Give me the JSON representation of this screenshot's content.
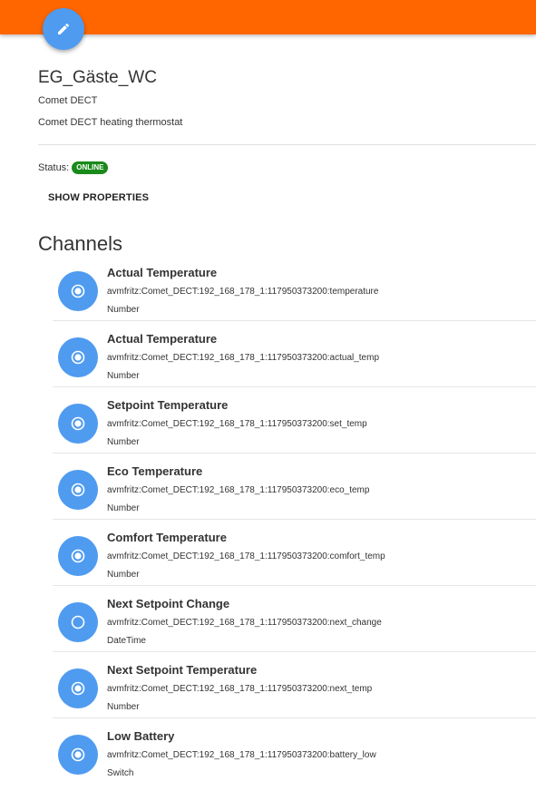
{
  "header": {
    "bar_color": "#ff6600",
    "edit_icon": "pencil-icon"
  },
  "thing": {
    "name": "EG_Gäste_WC",
    "type": "Comet DECT",
    "description": "Comet DECT heating thermostat",
    "status_label": "Status:",
    "status_value": "ONLINE",
    "status_color": "#1a8a1a",
    "show_properties_label": "SHOW PROPERTIES"
  },
  "channels": {
    "title": "Channels",
    "items": [
      {
        "label": "Actual Temperature",
        "uid": "avmfritz:Comet_DECT:192_168_178_1:117950373200:temperature",
        "type": "Number",
        "linked": true
      },
      {
        "label": "Actual Temperature",
        "uid": "avmfritz:Comet_DECT:192_168_178_1:117950373200:actual_temp",
        "type": "Number",
        "linked": true
      },
      {
        "label": "Setpoint Temperature",
        "uid": "avmfritz:Comet_DECT:192_168_178_1:117950373200:set_temp",
        "type": "Number",
        "linked": true
      },
      {
        "label": "Eco Temperature",
        "uid": "avmfritz:Comet_DECT:192_168_178_1:117950373200:eco_temp",
        "type": "Number",
        "linked": true
      },
      {
        "label": "Comfort Temperature",
        "uid": "avmfritz:Comet_DECT:192_168_178_1:117950373200:comfort_temp",
        "type": "Number",
        "linked": true
      },
      {
        "label": "Next Setpoint Change",
        "uid": "avmfritz:Comet_DECT:192_168_178_1:117950373200:next_change",
        "type": "DateTime",
        "linked": false
      },
      {
        "label": "Next Setpoint Temperature",
        "uid": "avmfritz:Comet_DECT:192_168_178_1:117950373200:next_temp",
        "type": "Number",
        "linked": true
      },
      {
        "label": "Low Battery",
        "uid": "avmfritz:Comet_DECT:192_168_178_1:117950373200:battery_low",
        "type": "Switch",
        "linked": true
      }
    ]
  }
}
